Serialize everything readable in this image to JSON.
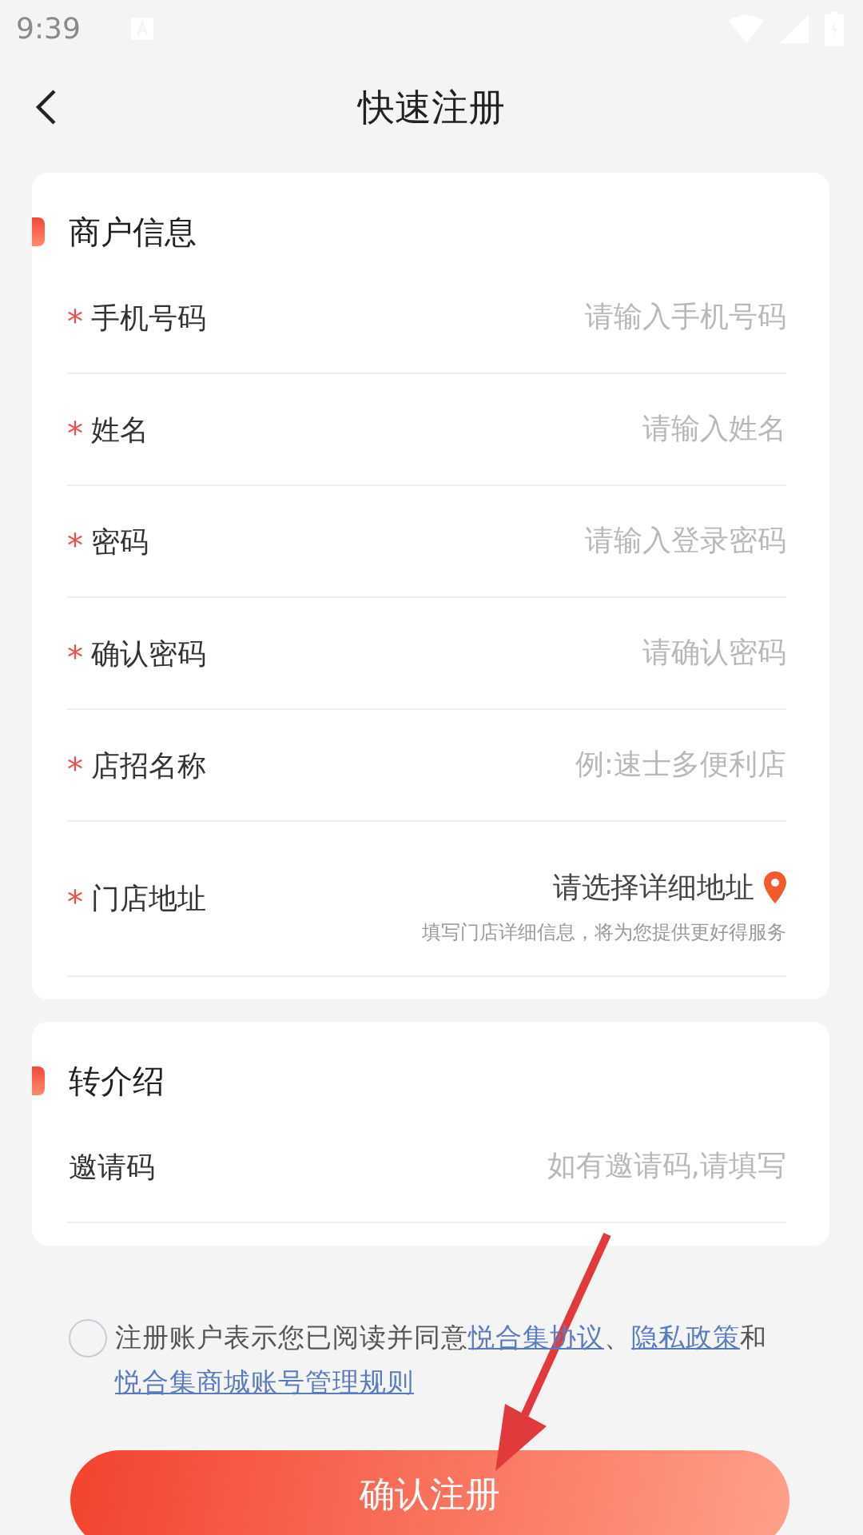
{
  "status_bar": {
    "time": "9:39"
  },
  "header": {
    "title": "快速注册"
  },
  "sections": [
    {
      "title": "商户信息",
      "rows": [
        {
          "kind": "input",
          "required_mark": "*",
          "label": "手机号码",
          "placeholder": "请输入手机号码"
        },
        {
          "kind": "input",
          "required_mark": "*",
          "label": "姓名",
          "placeholder": "请输入姓名"
        },
        {
          "kind": "input",
          "required_mark": "*",
          "label": "密码",
          "placeholder": "请输入登录密码"
        },
        {
          "kind": "input",
          "required_mark": "*",
          "label": "确认密码",
          "placeholder": "请确认密码"
        },
        {
          "kind": "input",
          "required_mark": "*",
          "label": "店招名称",
          "placeholder": "例:速士多便利店"
        },
        {
          "kind": "address",
          "required_mark": "*",
          "label": "门店地址",
          "value": "请选择详细地址",
          "hint": "填写门店详细信息，将为您提供更好得服务"
        }
      ]
    },
    {
      "title": "转介绍",
      "rows": [
        {
          "kind": "input",
          "label": "邀请码",
          "placeholder": "如有邀请码,请填写"
        }
      ]
    }
  ],
  "agreement": {
    "checked": false,
    "parts": [
      {
        "text": "注册账户表示您已阅读并同意",
        "link": false
      },
      {
        "text": "悦合集协议",
        "link": true
      },
      {
        "text": "、",
        "link": false
      },
      {
        "text": "隐私政策",
        "link": true
      },
      {
        "text": "和",
        "link": false
      },
      {
        "text": "悦合集商城账号管理规则",
        "link": true
      }
    ]
  },
  "submit": {
    "label": "确认注册"
  }
}
